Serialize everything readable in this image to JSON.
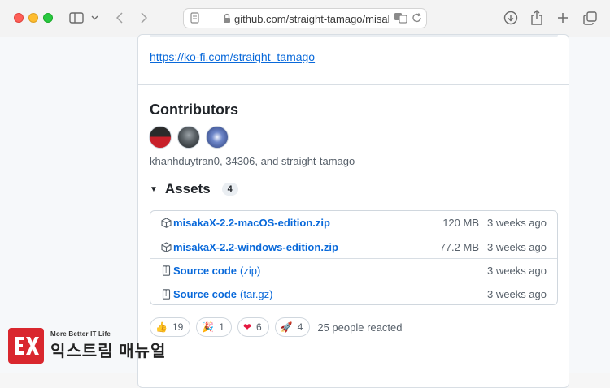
{
  "browser": {
    "address": "github.com/straight-tamago/misakaX",
    "icons": [
      "sidebar-icon",
      "chevron-down-icon",
      "back-icon",
      "forward-icon",
      "page-icon",
      "lock-icon",
      "translate-icon",
      "reload-icon",
      "download-icon",
      "share-icon",
      "new-tab-icon",
      "tabs-overview-icon"
    ]
  },
  "release": {
    "funding_link": "https://ko-fi.com/straight_tamago",
    "contributors_heading": "Contributors",
    "contributors_text": "khanhduytran0, 34306, and straight-tamago",
    "assets_heading": "Assets",
    "assets_count": "4",
    "assets": [
      {
        "name": "misakaX-2.2-macOS-edition.zip",
        "sub": "",
        "size": "120 MB",
        "date": "3 weeks ago",
        "icon": "package-icon"
      },
      {
        "name": "misakaX-2.2-windows-edition.zip",
        "sub": "",
        "size": "77.2 MB",
        "date": "3 weeks ago",
        "icon": "package-icon"
      },
      {
        "name": "Source code",
        "sub": "(zip)",
        "size": "",
        "date": "3 weeks ago",
        "icon": "file-zip-icon"
      },
      {
        "name": "Source code",
        "sub": "(tar.gz)",
        "size": "",
        "date": "3 weeks ago",
        "icon": "file-zip-icon"
      }
    ],
    "reactions": [
      {
        "emoji": "👍",
        "count": "19"
      },
      {
        "emoji": "🎉",
        "count": "1"
      },
      {
        "emoji": "❤",
        "count": "6"
      },
      {
        "emoji": "🚀",
        "count": "4"
      }
    ],
    "reacted_text": "25 people reacted"
  },
  "watermark": {
    "tagline": "More Better IT Life",
    "name": "익스트림 매뉴얼"
  },
  "colors": {
    "link": "#0969da",
    "traffic_red": "#fe5f57",
    "traffic_yellow": "#febc2e",
    "traffic_green": "#28c840"
  }
}
